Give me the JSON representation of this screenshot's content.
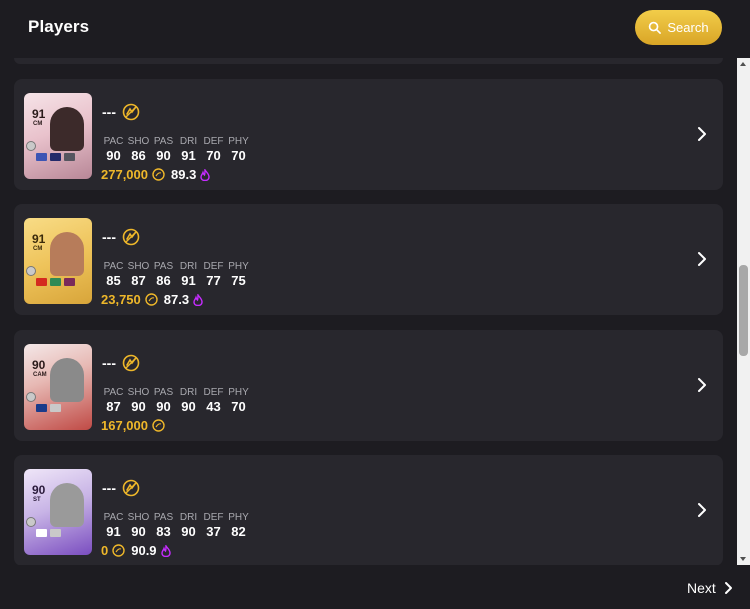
{
  "header": {
    "title": "Players",
    "search_label": "Search"
  },
  "colors": {
    "accent_gold": "#eeb72a",
    "fire_purple": "#c52cff",
    "card_bg": "#28272d"
  },
  "stat_labels": [
    "PAC",
    "SHO",
    "PAS",
    "DRI",
    "DEF",
    "PHY"
  ],
  "players": [
    {
      "name": "---",
      "card_rating": "91",
      "card_position": "CM",
      "card_style": "pink-special",
      "stats": [
        "90",
        "86",
        "90",
        "91",
        "70",
        "70"
      ],
      "price": "277,000",
      "rating": "89.3",
      "show_fire": true
    },
    {
      "name": "---",
      "card_rating": "91",
      "card_position": "CM",
      "card_style": "gold",
      "stats": [
        "85",
        "87",
        "86",
        "91",
        "77",
        "75"
      ],
      "price": "23,750",
      "rating": "87.3",
      "show_fire": true
    },
    {
      "name": "---",
      "card_rating": "90",
      "card_position": "CAM",
      "card_style": "red-special",
      "stats": [
        "87",
        "90",
        "90",
        "90",
        "43",
        "70"
      ],
      "price": "167,000",
      "rating": "",
      "show_fire": false
    },
    {
      "name": "---",
      "card_rating": "90",
      "card_position": "ST",
      "card_style": "purple-special",
      "stats": [
        "91",
        "90",
        "83",
        "90",
        "37",
        "82"
      ],
      "price": "0",
      "rating": "90.9",
      "show_fire": true
    }
  ],
  "footer": {
    "next_label": "Next"
  }
}
